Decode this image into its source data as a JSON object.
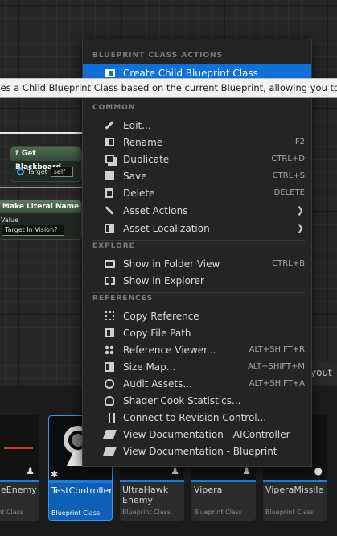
{
  "graph": {
    "blackboard_node": {
      "title": "Get Blackboard",
      "pin_label": "Target",
      "pin_value": "self"
    },
    "literal_node": {
      "title": "Make Literal Name",
      "value_label": "Value",
      "value": "Target In Vision?"
    },
    "layout_tab": "yout"
  },
  "tooltip": "tes a Child Blueprint Class based on the current Blueprint, allowing you to crea",
  "menu": {
    "sections": {
      "blueprint": "BLUEPRINT CLASS ACTIONS",
      "common": "COMMON",
      "explore": "EXPLORE",
      "references": "REFERENCES"
    },
    "blueprint_items": [
      {
        "label": "Create Child Blueprint Class",
        "icon": "child-blueprint-icon"
      }
    ],
    "common_items": [
      {
        "label": "Edit...",
        "shortcut": "",
        "icon": "pencil-icon"
      },
      {
        "label": "Rename",
        "shortcut": "F2",
        "icon": "rename-icon"
      },
      {
        "label": "Duplicate",
        "shortcut": "CTRL+D",
        "icon": "duplicate-icon"
      },
      {
        "label": "Save",
        "shortcut": "CTRL+S",
        "icon": "save-icon"
      },
      {
        "label": "Delete",
        "shortcut": "DELETE",
        "icon": "trash-icon"
      },
      {
        "label": "Asset Actions",
        "shortcut": "",
        "icon": "wrench-icon",
        "submenu": true
      },
      {
        "label": "Asset Localization",
        "shortcut": "",
        "icon": "localization-icon",
        "submenu": true
      }
    ],
    "explore_items": [
      {
        "label": "Show in Folder View",
        "shortcut": "CTRL+B",
        "icon": "folder-view-icon"
      },
      {
        "label": "Show in Explorer",
        "shortcut": "",
        "icon": "explorer-icon"
      }
    ],
    "reference_items": [
      {
        "label": "Copy Reference",
        "shortcut": "",
        "icon": "copy-reference-icon"
      },
      {
        "label": "Copy File Path",
        "shortcut": "",
        "icon": "copy-path-icon"
      },
      {
        "label": "Reference Viewer...",
        "shortcut": "ALT+SHIFT+R",
        "icon": "reference-viewer-icon"
      },
      {
        "label": "Size Map...",
        "shortcut": "ALT+SHIFT+M",
        "icon": "size-map-icon"
      },
      {
        "label": "Audit Assets...",
        "shortcut": "ALT+SHIFT+A",
        "icon": "audit-icon"
      },
      {
        "label": "Shader Cook Statistics...",
        "shortcut": "",
        "icon": "shader-stats-icon"
      },
      {
        "label": "Connect to Revision Control...",
        "shortcut": "",
        "icon": "revision-control-icon"
      },
      {
        "label": "View Documentation - AIController",
        "shortcut": "",
        "icon": "documentation-icon"
      },
      {
        "label": "View Documentation - Blueprint",
        "shortcut": "",
        "icon": "documentation-icon"
      }
    ]
  },
  "browser": {
    "tiles": [
      {
        "name": "eEnemy",
        "type": "int Class"
      },
      {
        "name": "TestController",
        "type": "Blueprint Class"
      },
      {
        "name": "UltraHawk Enemy",
        "type": "Blueprint Class"
      },
      {
        "name": "Vipera",
        "type": "Blueprint Class"
      },
      {
        "name": "ViperaMissile",
        "type": "Blueprint Class"
      }
    ]
  }
}
